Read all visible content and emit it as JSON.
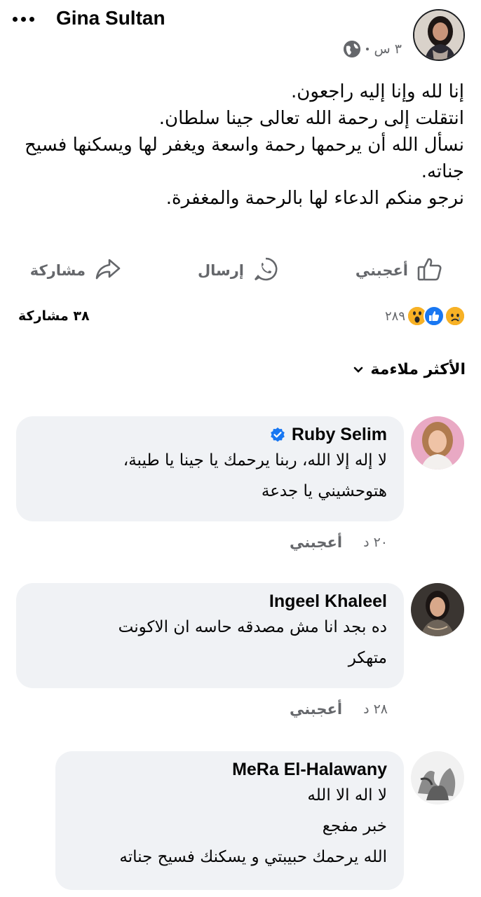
{
  "post": {
    "author": "Gina Sultan",
    "time": "٣ س",
    "lines": [
      "إنا لله وإنا إليه راجعون.",
      "انتقلت إلى رحمة الله تعالى جينا سلطان.",
      " نسأل الله أن يرحمها رحمة واسعة ويغفر لها ويسكنها فسيح",
      "جناته.",
      "نرجو منكم الدعاء لها بالرحمة والمغفرة."
    ]
  },
  "actions": {
    "like": "أعجبني",
    "send": "إرسال",
    "share": "مشاركة"
  },
  "stats": {
    "reactions_count": "٢٨٩",
    "reaction_types": [
      "sad-icon",
      "like-icon",
      "wow-icon"
    ],
    "shares": "٣٨ مشاركة"
  },
  "sort": {
    "label": "الأكثر ملاءمة"
  },
  "comments": [
    {
      "name": "Ruby Selim",
      "verified": true,
      "lines": [
        "لا إله إلا الله، ربنا يرحمك يا جينا يا طيبة،",
        "هتوحشيني يا جدعة"
      ],
      "time": "٢٠ د",
      "like": "أعجبني"
    },
    {
      "name": "Ingeel Khaleel",
      "verified": false,
      "lines": [
        "ده بجد  انا مش مصدقه حاسه ان الاكونت",
        "متهكر"
      ],
      "time": "٢٨ د",
      "like": "أعجبني"
    },
    {
      "name": "MeRa El-Halawany",
      "verified": false,
      "lines": [
        "لا اله الا الله",
        "خبر مفجع",
        "الله يرحمك حبيبتي و يسكنك فسيح جناته"
      ]
    }
  ],
  "colors": {
    "text": "#050505",
    "secondary": "#65676b",
    "bubble": "#f0f2f5",
    "verified": "#1877f2",
    "like_blue": "#1877f2",
    "reaction_yellow": "#f7b125"
  }
}
